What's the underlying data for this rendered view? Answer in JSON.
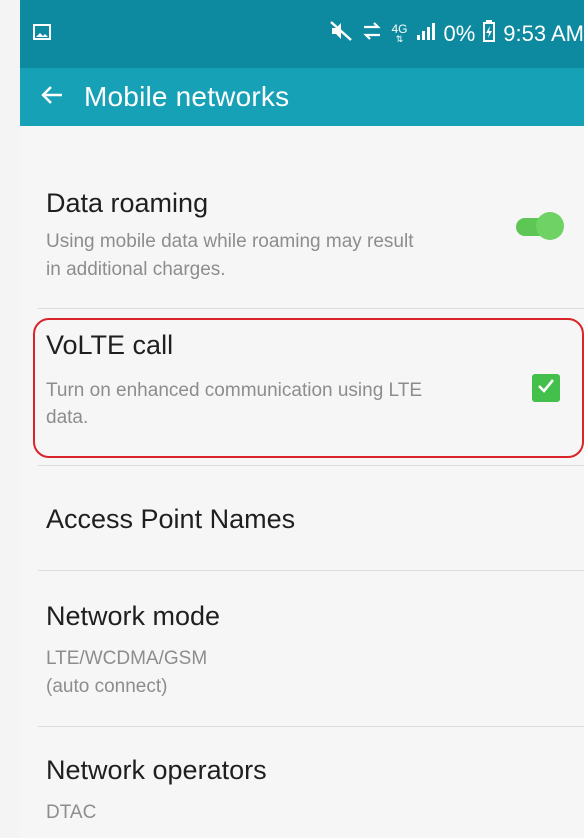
{
  "status_bar": {
    "icons": [
      "image-icon",
      "mute-icon",
      "data-transfer-icon",
      "4g-icon",
      "signal-icon",
      "battery-icon"
    ],
    "battery": "0%",
    "time": "9:53 AM",
    "network_badge": "4G"
  },
  "app_bar": {
    "title": "Mobile networks",
    "back_icon": "arrow-left-icon"
  },
  "settings": {
    "data_roaming": {
      "title": "Data roaming",
      "subtitle_line1": "Using mobile data while roaming may result",
      "subtitle_line2": "in additional charges.",
      "enabled": true
    },
    "volte_call": {
      "title": "VoLTE call",
      "subtitle_line1": "Turn on enhanced communication using LTE",
      "subtitle_line2": "data.",
      "checked": true
    },
    "access_point_names": {
      "title": "Access Point Names"
    },
    "network_mode": {
      "title": "Network mode",
      "subtitle_line1": "LTE/WCDMA/GSM",
      "subtitle_line2": "(auto connect)"
    },
    "network_operators": {
      "title": "Network operators",
      "subtitle": "DTAC"
    }
  },
  "colors": {
    "status_bar": "#0d8a9f",
    "app_bar": "#16a1b6",
    "toggle_on": "#5ec654",
    "checkbox_on": "#43c04b",
    "highlight": "#d9242a"
  }
}
